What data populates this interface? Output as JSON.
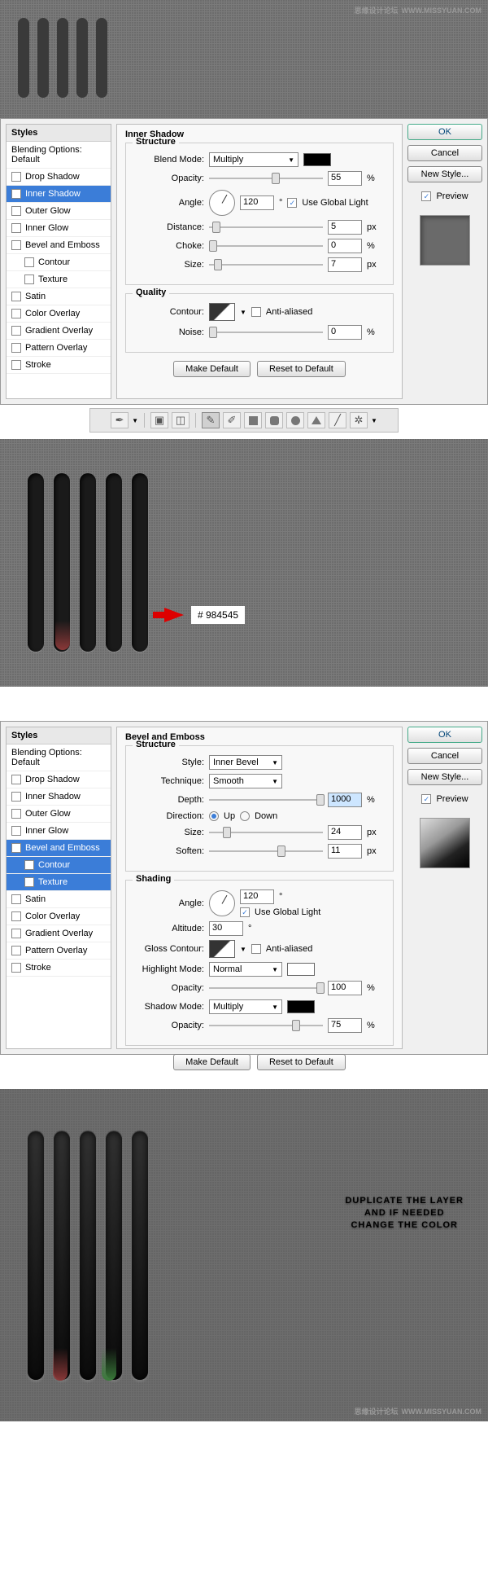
{
  "watermark": {
    "text": "思缘设计论坛",
    "url": "WWW.MISSYUAN.COM"
  },
  "styles_list": [
    {
      "label": "Blending Options: Default",
      "checked": false,
      "header": true
    },
    {
      "label": "Drop Shadow",
      "checked": false
    },
    {
      "label": "Inner Shadow",
      "checked": true,
      "selected": true
    },
    {
      "label": "Outer Glow",
      "checked": false
    },
    {
      "label": "Inner Glow",
      "checked": false
    },
    {
      "label": "Bevel and Emboss",
      "checked": false
    },
    {
      "label": "Contour",
      "checked": false,
      "sub": true
    },
    {
      "label": "Texture",
      "checked": false,
      "sub": true
    },
    {
      "label": "Satin",
      "checked": false
    },
    {
      "label": "Color Overlay",
      "checked": false
    },
    {
      "label": "Gradient Overlay",
      "checked": false
    },
    {
      "label": "Pattern Overlay",
      "checked": false
    },
    {
      "label": "Stroke",
      "checked": false
    }
  ],
  "styles_list2": [
    {
      "label": "Blending Options: Default",
      "checked": false,
      "header": true
    },
    {
      "label": "Drop Shadow",
      "checked": false
    },
    {
      "label": "Inner Shadow",
      "checked": false
    },
    {
      "label": "Outer Glow",
      "checked": false
    },
    {
      "label": "Inner Glow",
      "checked": false
    },
    {
      "label": "Bevel and Emboss",
      "checked": true,
      "selected": true
    },
    {
      "label": "Contour",
      "checked": false,
      "sub": true,
      "selected": true
    },
    {
      "label": "Texture",
      "checked": false,
      "sub": true,
      "selected": true
    },
    {
      "label": "Satin",
      "checked": false
    },
    {
      "label": "Color Overlay",
      "checked": false
    },
    {
      "label": "Gradient Overlay",
      "checked": false
    },
    {
      "label": "Pattern Overlay",
      "checked": false
    },
    {
      "label": "Stroke",
      "checked": false
    }
  ],
  "panel1": {
    "title": "Inner Shadow",
    "structure_label": "Structure",
    "blend_mode_lbl": "Blend Mode:",
    "blend_mode": "Multiply",
    "opacity_lbl": "Opacity:",
    "opacity": "55",
    "angle_lbl": "Angle:",
    "angle": "120",
    "degree": "°",
    "global_light": "Use Global Light",
    "distance_lbl": "Distance:",
    "distance": "5",
    "choke_lbl": "Choke:",
    "choke": "0",
    "size_lbl": "Size:",
    "size": "7",
    "quality_label": "Quality",
    "contour_lbl": "Contour:",
    "anti_aliased": "Anti-aliased",
    "noise_lbl": "Noise:",
    "noise": "0",
    "pct": "%",
    "px": "px",
    "make_default": "Make Default",
    "reset_default": "Reset to Default"
  },
  "panel2": {
    "title": "Bevel and Emboss",
    "structure_label": "Structure",
    "style_lbl": "Style:",
    "style": "Inner Bevel",
    "technique_lbl": "Technique:",
    "technique": "Smooth",
    "depth_lbl": "Depth:",
    "depth": "1000",
    "direction_lbl": "Direction:",
    "dir_up": "Up",
    "dir_down": "Down",
    "size_lbl": "Size:",
    "size": "24",
    "soften_lbl": "Soften:",
    "soften": "11",
    "shading_label": "Shading",
    "angle_lbl": "Angle:",
    "angle": "120",
    "degree": "°",
    "global_light": "Use Global Light",
    "altitude_lbl": "Altitude:",
    "altitude": "30",
    "gloss_lbl": "Gloss Contour:",
    "anti_aliased": "Anti-aliased",
    "hl_mode_lbl": "Highlight Mode:",
    "hl_mode": "Normal",
    "hl_opacity": "100",
    "sh_mode_lbl": "Shadow Mode:",
    "sh_mode": "Multiply",
    "sh_opacity": "75",
    "opacity_lbl": "Opacity:",
    "pct": "%",
    "px": "px",
    "make_default": "Make Default",
    "reset_default": "Reset to Default"
  },
  "buttons": {
    "ok": "OK",
    "cancel": "Cancel",
    "new_style": "New Style...",
    "preview": "Preview",
    "styles": "Styles"
  },
  "color_callout": "#  984545",
  "big_text_1": "DUPLICATE THE LAYER",
  "big_text_2": "AND IF NEEDED",
  "big_text_3": "CHANGE THE COLOR"
}
